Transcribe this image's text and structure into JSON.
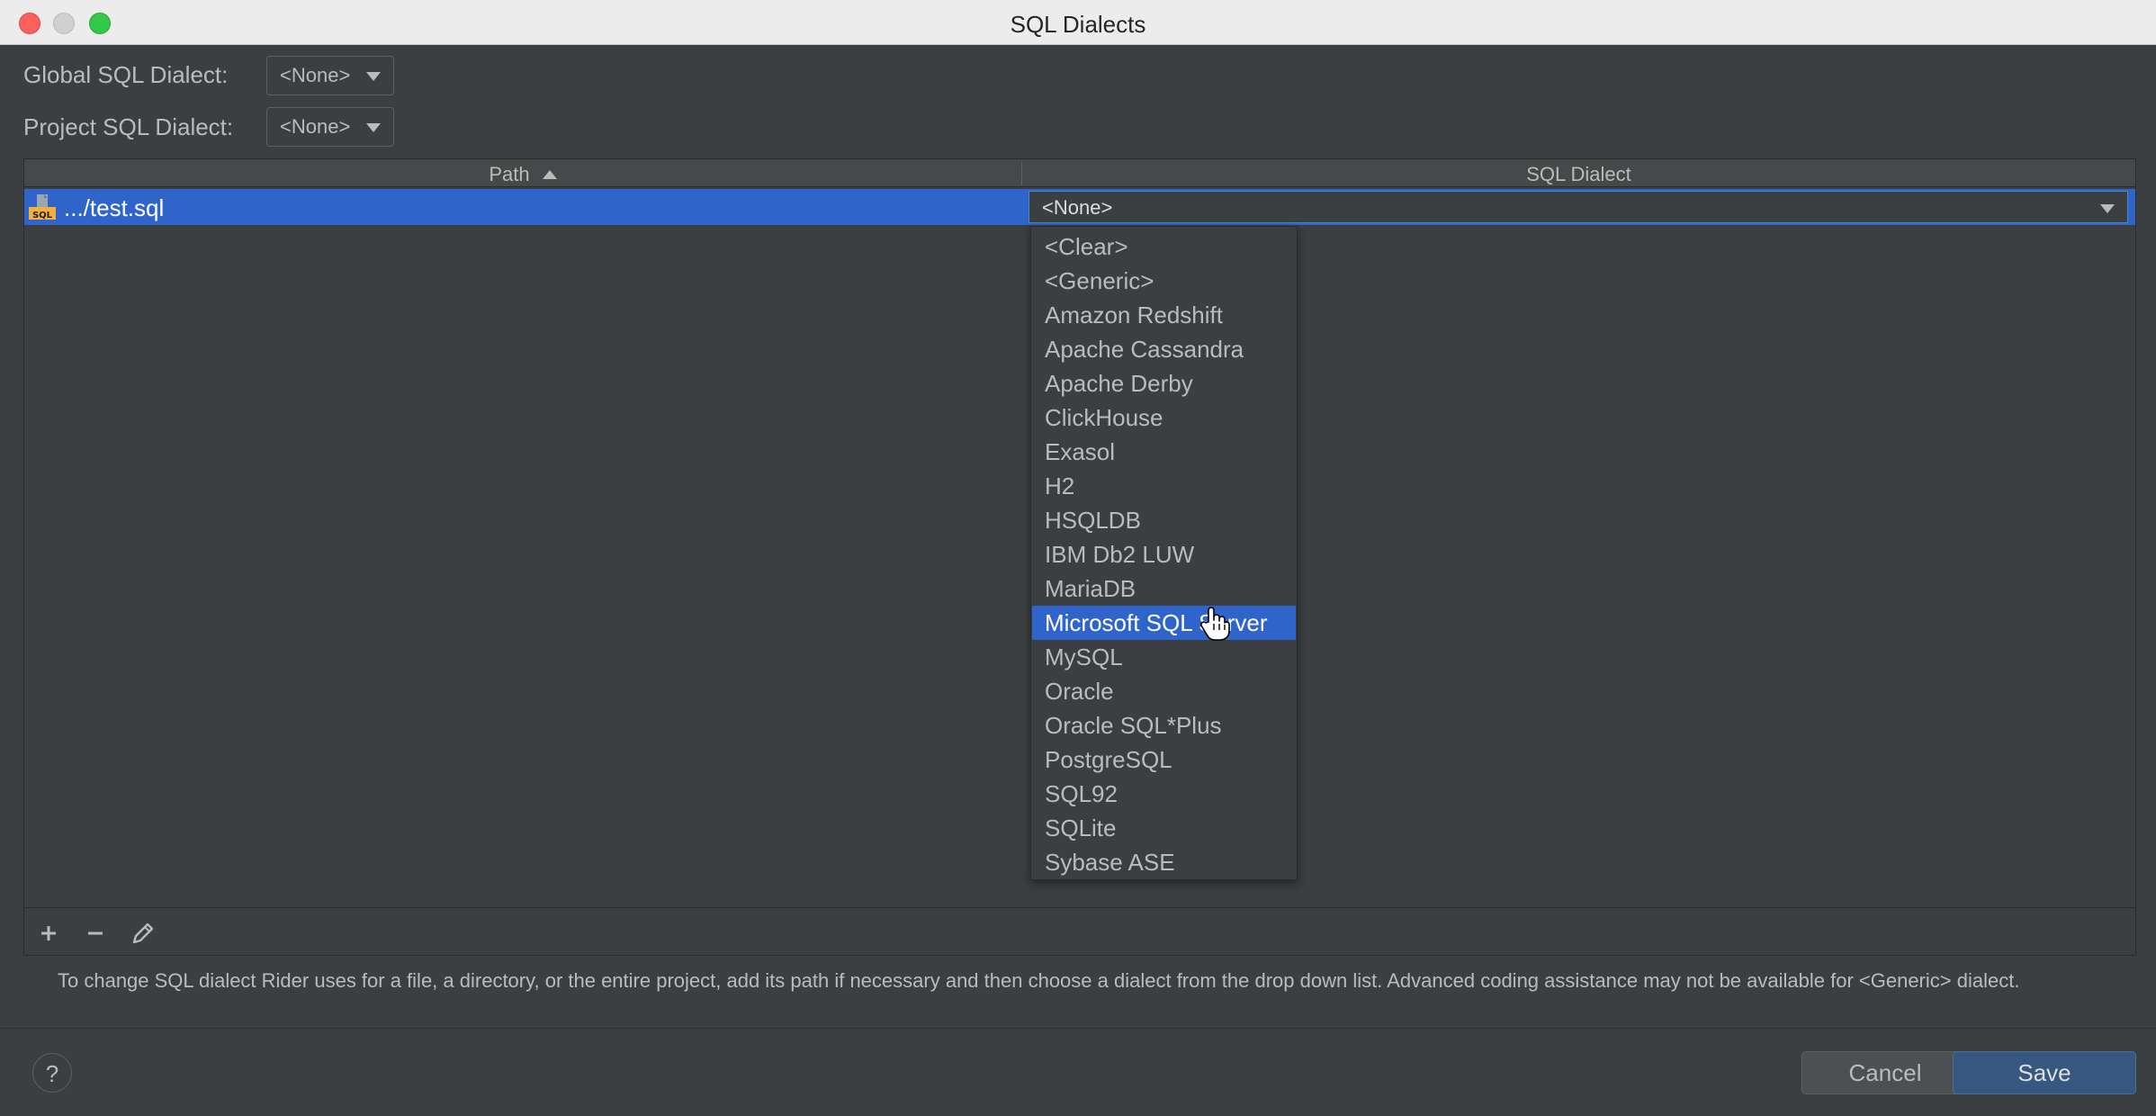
{
  "window": {
    "title": "SQL Dialects"
  },
  "global_dialect": {
    "label": "Global SQL Dialect:",
    "value": "<None>"
  },
  "project_dialect": {
    "label": "Project SQL Dialect:",
    "value": "<None>"
  },
  "table": {
    "columns": [
      "Path",
      "SQL Dialect"
    ],
    "rows": [
      {
        "path": ".../test.sql",
        "dialect": "<None>",
        "icon": "sql-file-icon"
      }
    ]
  },
  "dropdown": {
    "options": [
      "<Clear>",
      "<Generic>",
      "Amazon Redshift",
      "Apache Cassandra",
      "Apache Derby",
      "ClickHouse",
      "Exasol",
      "H2",
      "HSQLDB",
      "IBM Db2 LUW",
      "MariaDB",
      "Microsoft SQL Server",
      "MySQL",
      "Oracle",
      "Oracle SQL*Plus",
      "PostgreSQL",
      "SQL92",
      "SQLite",
      "Sybase ASE"
    ],
    "highlighted": "Microsoft SQL Server"
  },
  "toolbar": {
    "add_icon": "plus-icon",
    "remove_icon": "minus-icon",
    "edit_icon": "pencil-icon"
  },
  "hint": "To change SQL dialect Rider uses for a file, a directory, or the entire project, add its path if necessary and then choose a dialect from the drop down list. Advanced coding assistance may not be available for <Generic> dialect.",
  "buttons": {
    "help": "?",
    "cancel": "Cancel",
    "save": "Save"
  },
  "colors": {
    "selection": "#2f65ca",
    "background": "#3c3f41",
    "primary_button": "#365880"
  }
}
